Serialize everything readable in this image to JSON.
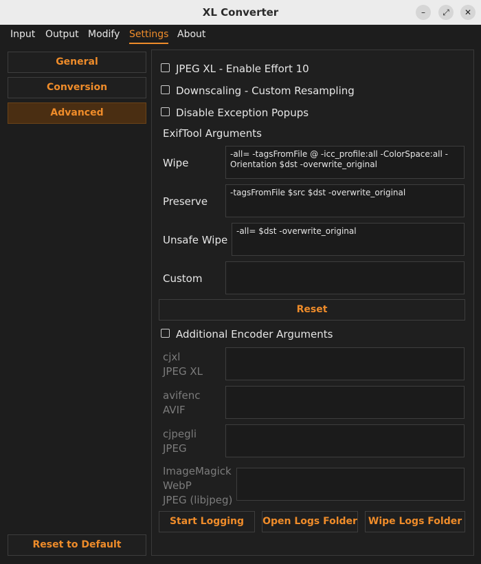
{
  "window": {
    "title": "XL Converter",
    "minimize_glyph": "–",
    "maximize_glyph": "⤢",
    "close_glyph": "✕"
  },
  "menu": {
    "items": [
      "Input",
      "Output",
      "Modify",
      "Settings",
      "About"
    ],
    "active": "Settings"
  },
  "sidebar": {
    "items": [
      "General",
      "Conversion",
      "Advanced"
    ],
    "active": "Advanced",
    "reset_default_label": "Reset to Default"
  },
  "advanced": {
    "checkboxes": [
      {
        "label": "JPEG XL - Enable Effort 10",
        "checked": false
      },
      {
        "label": "Downscaling - Custom Resampling",
        "checked": false
      },
      {
        "label": "Disable Exception Popups",
        "checked": false
      }
    ],
    "exiftool": {
      "section_label": "ExifTool Arguments",
      "fields": [
        {
          "label": "Wipe",
          "value": "-all= -tagsFromFile @ -icc_profile:all -ColorSpace:all -Orientation $dst -overwrite_original"
        },
        {
          "label": "Preserve",
          "value": "-tagsFromFile $src $dst -overwrite_original"
        },
        {
          "label": "Unsafe Wipe",
          "value": "-all= $dst -overwrite_original"
        },
        {
          "label": "Custom",
          "value": ""
        }
      ],
      "reset_label": "Reset"
    },
    "encoder": {
      "checkbox_label": "Additional Encoder Arguments",
      "checked": false,
      "fields": [
        {
          "label_lines": [
            "cjxl",
            "JPEG XL"
          ],
          "value": ""
        },
        {
          "label_lines": [
            "avifenc",
            "AVIF"
          ],
          "value": ""
        },
        {
          "label_lines": [
            "cjpegli",
            "JPEG"
          ],
          "value": ""
        },
        {
          "label_lines": [
            "ImageMagick",
            "WebP",
            "JPEG (libjpeg)"
          ],
          "value": ""
        }
      ]
    },
    "buttons": {
      "start_logging": "Start Logging",
      "open_logs": "Open Logs Folder",
      "wipe_logs": "Wipe Logs Folder"
    }
  },
  "colors": {
    "accent": "#ef8c2a",
    "background": "#1d1d1d",
    "active_tab_bg": "#4a2e12"
  }
}
